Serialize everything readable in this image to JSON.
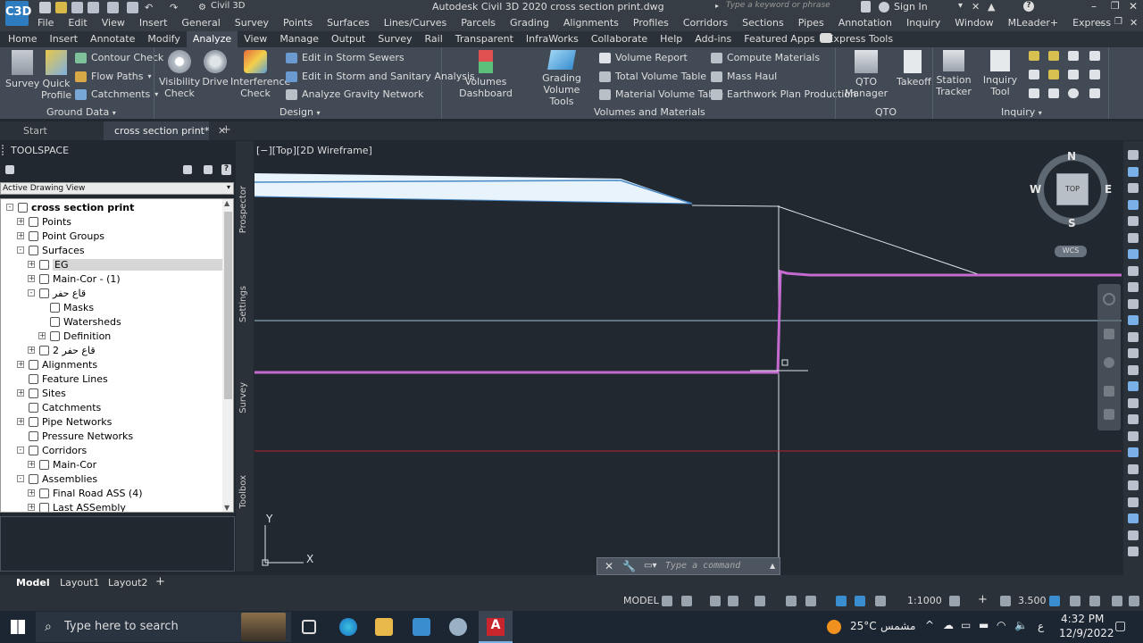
{
  "titlebar": {
    "workspace": "Civil 3D",
    "app_title": "Autodesk Civil 3D 2020    cross section print.dwg",
    "search_placeholder": "Type a keyword or phrase",
    "sign_in": "Sign In"
  },
  "logo": {
    "label": "C3D"
  },
  "menubar": [
    "File",
    "Edit",
    "View",
    "Insert",
    "General",
    "Survey",
    "Points",
    "Surfaces",
    "Lines/Curves",
    "Parcels",
    "Grading",
    "Alignments",
    "Profiles",
    "Corridors",
    "Sections",
    "Pipes",
    "Annotation",
    "Inquiry",
    "Window",
    "MLeader+",
    "Express"
  ],
  "ribbon_tabs": [
    {
      "label": "Home",
      "active": false
    },
    {
      "label": "Insert",
      "active": false
    },
    {
      "label": "Annotate",
      "active": false
    },
    {
      "label": "Modify",
      "active": false
    },
    {
      "label": "Analyze",
      "active": true
    },
    {
      "label": "View",
      "active": false
    },
    {
      "label": "Manage",
      "active": false
    },
    {
      "label": "Output",
      "active": false
    },
    {
      "label": "Survey",
      "active": false
    },
    {
      "label": "Rail",
      "active": false
    },
    {
      "label": "Transparent",
      "active": false
    },
    {
      "label": "InfraWorks",
      "active": false
    },
    {
      "label": "Collaborate",
      "active": false
    },
    {
      "label": "Help",
      "active": false
    },
    {
      "label": "Add-ins",
      "active": false
    },
    {
      "label": "Featured Apps",
      "active": false
    },
    {
      "label": "Express Tools",
      "active": false
    }
  ],
  "ribbon": {
    "ground_data": {
      "label": "Ground Data",
      "survey": "Survey",
      "quick_profile_1": "Quick",
      "quick_profile_2": "Profile",
      "contour_check": "Contour Check",
      "flow_paths": "Flow Paths",
      "catchments": "Catchments"
    },
    "design": {
      "label": "Design",
      "visibility_1": "Visibility",
      "visibility_2": "Check",
      "drive": "Drive",
      "interference_1": "Interference",
      "interference_2": "Check",
      "storm_sewers": "Edit in Storm Sewers",
      "storm_sanitary": "Edit in Storm and Sanitary Analysis",
      "gravity_network": "Analyze Gravity Network"
    },
    "volumes": {
      "label": "Volumes and Materials",
      "volumes_dashboard": "Volumes Dashboard",
      "grading_1": "Grading Volume",
      "grading_2": "Tools",
      "volume_report": "Volume Report",
      "total_volume_table": "Total Volume Table",
      "material_volume_table": "Material Volume Table",
      "compute_materials": "Compute Materials",
      "mass_haul": "Mass Haul",
      "earthwork_plan": "Earthwork Plan Production"
    },
    "qto": {
      "label": "QTO",
      "qto_manager": "QTO Manager",
      "takeoff": "Takeoff"
    },
    "inquiry": {
      "label": "Inquiry",
      "station_1": "Station",
      "station_2": "Tracker",
      "inquiry_tool": "Inquiry Tool"
    }
  },
  "doc_tabs": {
    "start": "Start",
    "file": "cross section print*"
  },
  "toolspace": {
    "title": "TOOLSPACE",
    "view_dropdown": "Active Drawing View",
    "tree": [
      {
        "label": "cross section print",
        "level": 0,
        "toggle": "-",
        "bold": true,
        "selected": false
      },
      {
        "label": "Points",
        "level": 1,
        "toggle": "+",
        "bold": false,
        "selected": false
      },
      {
        "label": "Point Groups",
        "level": 1,
        "toggle": "+",
        "bold": false,
        "selected": false
      },
      {
        "label": "Surfaces",
        "level": 1,
        "toggle": "-",
        "bold": false,
        "selected": false
      },
      {
        "label": "EG",
        "level": 2,
        "toggle": "+",
        "bold": false,
        "selected": true
      },
      {
        "label": "Main-Cor - (1)",
        "level": 2,
        "toggle": "+",
        "bold": false,
        "selected": false
      },
      {
        "label": "قاع حفر",
        "level": 2,
        "toggle": "-",
        "bold": false,
        "selected": false
      },
      {
        "label": "Masks",
        "level": 3,
        "toggle": "",
        "bold": false,
        "selected": false
      },
      {
        "label": "Watersheds",
        "level": 3,
        "toggle": "",
        "bold": false,
        "selected": false
      },
      {
        "label": "Definition",
        "level": 3,
        "toggle": "+",
        "bold": false,
        "selected": false
      },
      {
        "label": "قاع حفر 2",
        "level": 2,
        "toggle": "+",
        "bold": false,
        "selected": false
      },
      {
        "label": "Alignments",
        "level": 1,
        "toggle": "+",
        "bold": false,
        "selected": false
      },
      {
        "label": "Feature Lines",
        "level": 1,
        "toggle": "",
        "bold": false,
        "selected": false
      },
      {
        "label": "Sites",
        "level": 1,
        "toggle": "+",
        "bold": false,
        "selected": false
      },
      {
        "label": "Catchments",
        "level": 1,
        "toggle": "",
        "bold": false,
        "selected": false
      },
      {
        "label": "Pipe Networks",
        "level": 1,
        "toggle": "+",
        "bold": false,
        "selected": false
      },
      {
        "label": "Pressure Networks",
        "level": 1,
        "toggle": "",
        "bold": false,
        "selected": false
      },
      {
        "label": "Corridors",
        "level": 1,
        "toggle": "-",
        "bold": false,
        "selected": false
      },
      {
        "label": "Main-Cor",
        "level": 2,
        "toggle": "+",
        "bold": false,
        "selected": false
      },
      {
        "label": "Assemblies",
        "level": 1,
        "toggle": "-",
        "bold": false,
        "selected": false
      },
      {
        "label": "Final Road ASS (4)",
        "level": 2,
        "toggle": "+",
        "bold": false,
        "selected": false
      },
      {
        "label": "Last ASSembly",
        "level": 2,
        "toggle": "+",
        "bold": false,
        "selected": false
      }
    ]
  },
  "vertical_tabs": [
    "Prospector",
    "Settings",
    "Survey",
    "Toolbox"
  ],
  "viewport": {
    "label": "[−][Top][2D Wireframe]",
    "navcube": {
      "top": "TOP",
      "n": "N",
      "s": "S",
      "e": "E",
      "w": "W",
      "wcs": "WCS"
    },
    "ucs": {
      "x": "X",
      "y": "Y"
    },
    "colors": {
      "background": "#212830",
      "magenta": "#c66ad0",
      "red": "#b8252a",
      "white": "#dde3ea",
      "cyan_fill": "#e8f3fb"
    }
  },
  "command_line": {
    "placeholder": "Type a command"
  },
  "layout_tabs": [
    "Model",
    "Layout1",
    "Layout2"
  ],
  "statusbar": {
    "model": "MODEL",
    "scale": "1:1000",
    "value": "3.500"
  },
  "taskbar": {
    "search_placeholder": "Type here to search",
    "weather": "25°C",
    "weather_desc": "مشمس",
    "lang": "ع",
    "time": "4:32 PM",
    "date": "12/9/2022"
  }
}
